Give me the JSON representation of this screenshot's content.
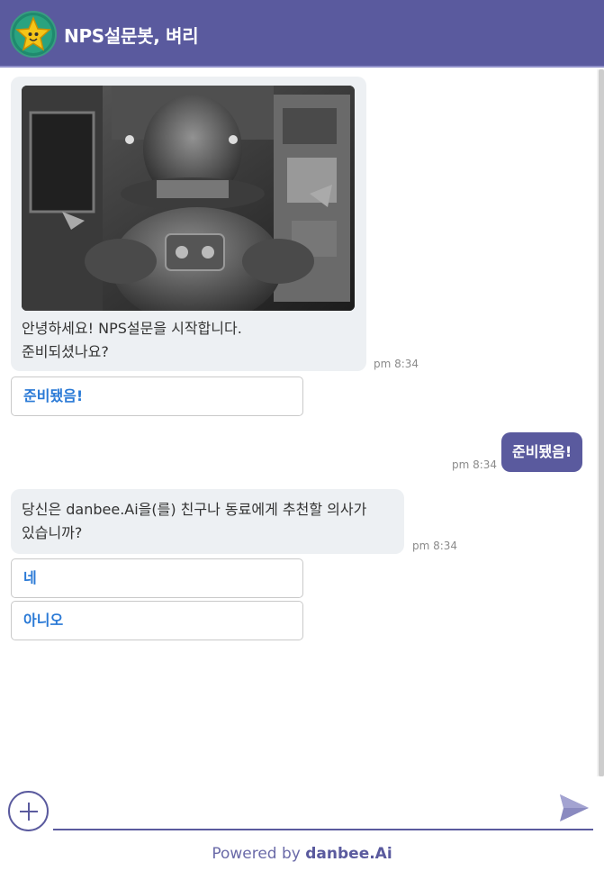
{
  "header": {
    "title": "NPS설문봇, 벼리",
    "avatar_icon": "star-mascot-icon"
  },
  "messages": {
    "greeting": {
      "image_alt": "robot photo",
      "line1": "안녕하세요! NPS설문을 시작합니다.",
      "line2": "준비되셨나요?",
      "time": "pm 8:34",
      "quick_reply": "준비됐음!"
    },
    "user_reply": {
      "text": "준비됐음!",
      "time": "pm 8:34"
    },
    "question": {
      "line1": "당신은 danbee.Ai을(를) 친구나 동료에게 추천할 의사가",
      "line2": "있습니까?",
      "time": "pm 8:34",
      "options": [
        "네",
        "아니오"
      ]
    }
  },
  "composer": {
    "placeholder": "",
    "plus_icon": "plus-icon",
    "send_icon": "send-icon"
  },
  "footer": {
    "powered_prefix": "Powered by ",
    "brand": "danbee.Ai"
  },
  "colors": {
    "primary": "#5a5a9e",
    "bot_bubble": "#edf0f3",
    "link_blue": "#2979d6"
  }
}
